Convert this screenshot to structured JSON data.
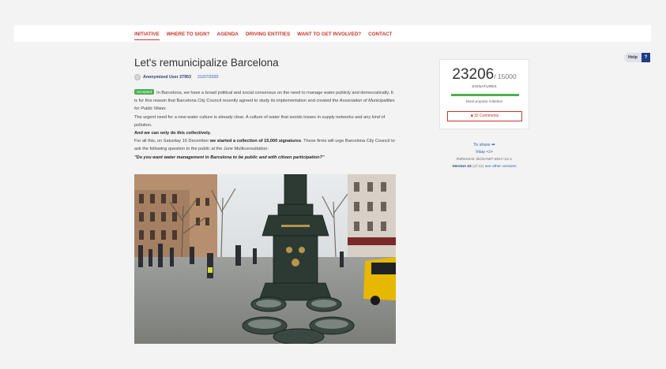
{
  "nav": {
    "items": [
      "INITIATIVE",
      "WHERE TO SIGN?",
      "AGENDA",
      "DRIVING ENTITIES",
      "WANT TO GET INVOLVED?",
      "CONTACT"
    ]
  },
  "help": {
    "label": "Help",
    "icon_label": "?"
  },
  "initiative": {
    "title": "Let's remunicipalize Barcelona",
    "author": "Anonymized User 27953",
    "date": "21/07/2020",
    "status_badge": "Accepted",
    "p1_text": "In Barcelona, we have a broad political and social consensus on the need to manage water publicly and democratically. It is for this reason that Barcelona City Council recently agreed to study its implementation and created ",
    "p1_italic": "the Association of Municipalities for Public Water.",
    "p2": "The urgent need for a new water culture is already clear. A culture of water that avoids losses in supply networks and any kind of pollution.",
    "p3": "And we can only do this collectively.",
    "p4_start": "For all this, on Saturday 16 December ",
    "p4_bold": "we started a collection of 15,000 signatures",
    "p4_end": ". These firms will urge Barcelona City Council to ask the following question to the public at the June Multiconsultation:",
    "question": "\"Do you want water management in Barcelona to be public and with citizen participation?\""
  },
  "signatures": {
    "count": "23206",
    "goal": "/ 15000",
    "label": "SIGNATURES",
    "progress_percent": 100,
    "popular_label": "Most popular initiative",
    "comments_button": "33 Comments"
  },
  "sidebar": {
    "share": "To share",
    "inlay": "Inlay",
    "reference": "Reference: BCN-INIT-2017-12-1",
    "version_label": "Version 22",
    "version_of": "(of 22)",
    "versions_link": "see other versions"
  },
  "colors": {
    "accent_red": "#c8362b",
    "progress_green": "#4caf50",
    "help_blue": "#1f3c88"
  }
}
